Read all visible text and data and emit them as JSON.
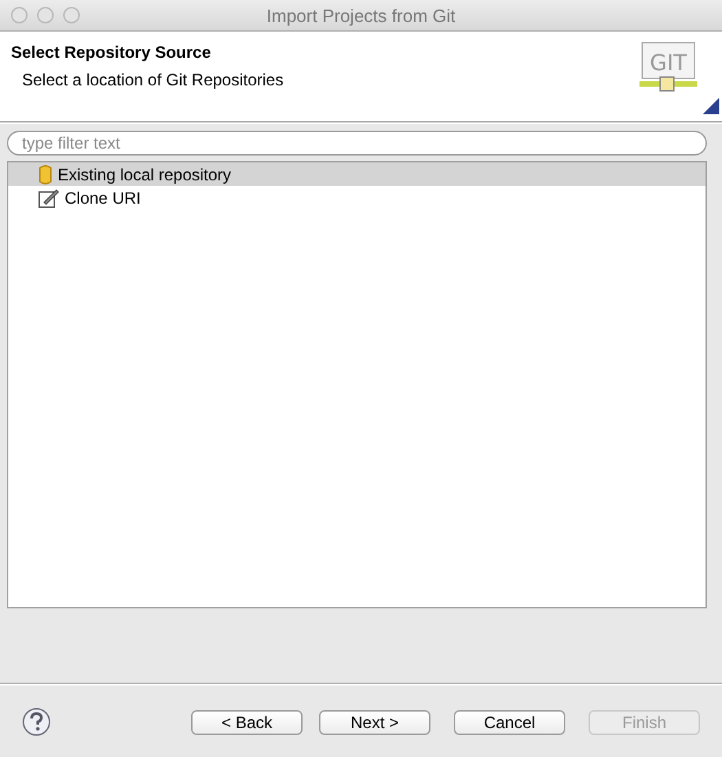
{
  "window": {
    "title": "Import Projects from Git"
  },
  "header": {
    "title": "Select Repository Source",
    "subtitle": "Select a location of Git Repositories",
    "logo_text": "GIT"
  },
  "filter": {
    "placeholder": "type filter text"
  },
  "items": [
    {
      "label": "Existing local repository",
      "kind": "repository",
      "selected": true
    },
    {
      "label": "Clone URI",
      "kind": "clone",
      "selected": false
    }
  ],
  "nav_buttons": [
    {
      "label": "< Back",
      "disabled": false
    },
    {
      "label": "Next >",
      "disabled": false
    }
  ],
  "action_buttons": [
    {
      "label": "Cancel",
      "disabled": false
    },
    {
      "label": "Finish",
      "disabled": true
    }
  ]
}
